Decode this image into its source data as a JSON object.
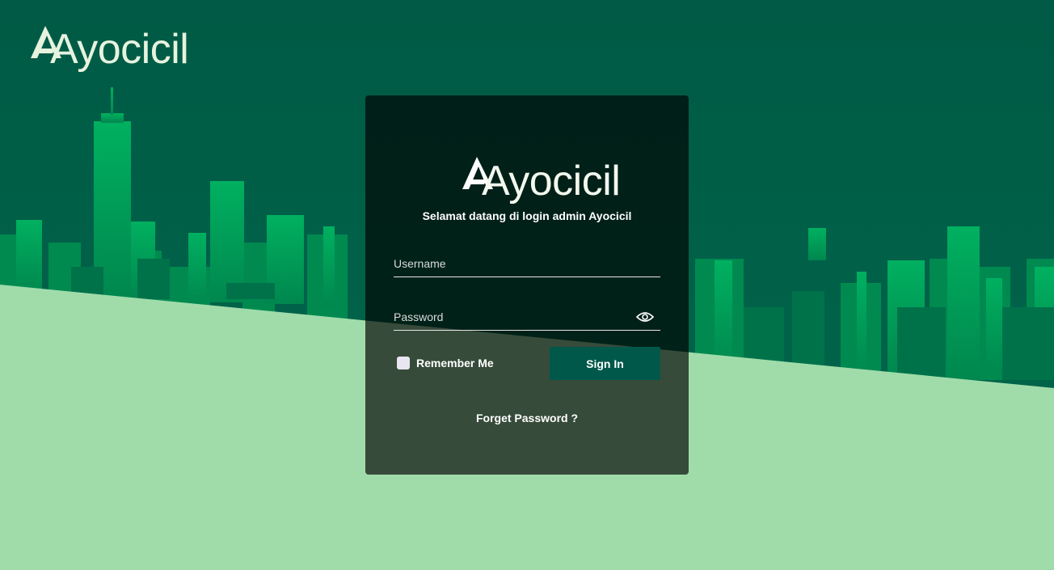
{
  "brand": {
    "name": "Ayocicil",
    "colors": {
      "dark_green": "#005a45",
      "city_green": "#00a35a",
      "light_green": "#a0dcaa",
      "logo_text": "#e6f3df"
    }
  },
  "login": {
    "welcome_text": "Selamat datang di login admin Ayocicil",
    "username_placeholder": "Username",
    "password_placeholder": "Password",
    "remember_label": "Remember Me",
    "signin_label": "Sign In",
    "forgot_label": "Forget Password ?",
    "icons": {
      "password_toggle": "eye-icon",
      "checkbox": "checkbox-unchecked"
    }
  }
}
